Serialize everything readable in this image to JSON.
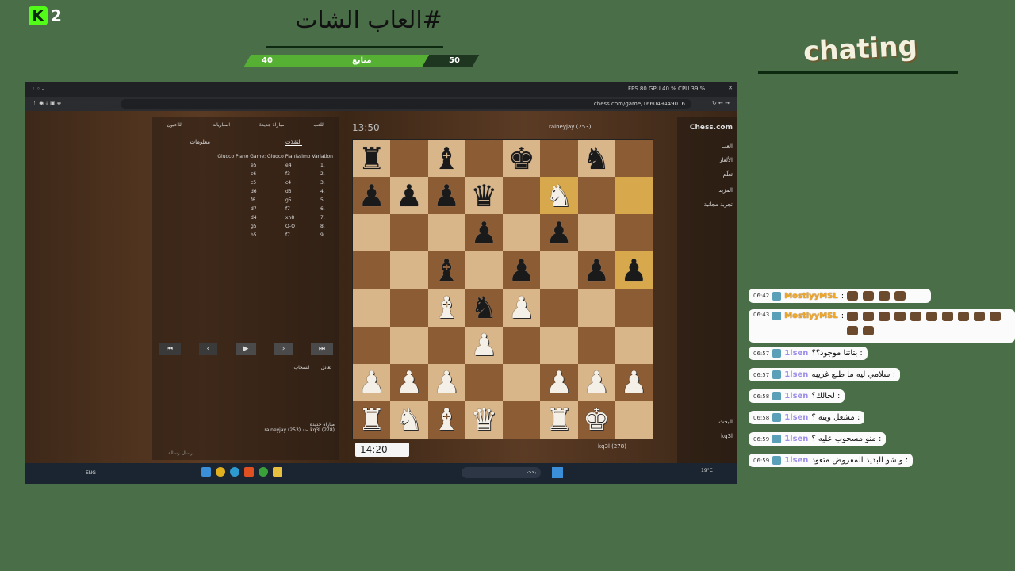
{
  "overlay": {
    "badge_number": "2",
    "title": "#العاب الشات",
    "poll_left_value": "40",
    "poll_center_label": "متابع",
    "poll_right_value": "50",
    "chat_heading": "chating"
  },
  "browser": {
    "tab_stats": "FPS 80 GPU 40 % CPU 39 %",
    "url": "chess.com/game/166049449016"
  },
  "game": {
    "top_clock": "13:50",
    "bottom_clock": "14:20",
    "top_player": "raineyjay (253)",
    "bottom_player": "kq3l (278)",
    "tab_moves": "النقلات",
    "tab_info": "معلومات",
    "opening": "Giuoco Piano Game: Giuoco Pianissimo Variation",
    "moves": [
      [
        "1.",
        "e4",
        "e5"
      ],
      [
        "2.",
        "f3",
        "c6"
      ],
      [
        "3.",
        "c4",
        "c5"
      ],
      [
        "4.",
        "d3",
        "d6"
      ],
      [
        "5.",
        "g5",
        "f6"
      ],
      [
        "6.",
        "f7",
        "d7"
      ],
      [
        "7.",
        "xh8",
        "d4"
      ],
      [
        "8.",
        "O-O",
        "g5"
      ],
      [
        "9.",
        "f7",
        "h5"
      ]
    ],
    "draw_label": "تعادل",
    "resign_label": "انسحاب",
    "new_game_label": "مباراة جديدة",
    "summary_line": "raineyjay (253) ضد kq3l (278)",
    "send_placeholder": "إرسال رسالة...",
    "top_icons": [
      "اللعب",
      "مباراة جديدة",
      "المباريات",
      "اللاعبون"
    ]
  },
  "chess_nav": {
    "brand": "Chess.com",
    "items": [
      "العب",
      "الألغاز",
      "تعلّم",
      "المزيد",
      "تجربة مجانية"
    ],
    "search": "البحث",
    "user": "kq3l"
  },
  "taskbar": {
    "search": "بحث",
    "weather": "19°C",
    "lang": "ENG"
  },
  "board": [
    [
      "bR",
      "",
      "bB",
      "",
      "bK",
      "",
      "bN",
      ""
    ],
    [
      "bP",
      "bP",
      "bP",
      "bQ",
      "",
      "wN",
      "",
      ""
    ],
    [
      "",
      "",
      "",
      "bP",
      "",
      "bP",
      "",
      ""
    ],
    [
      "",
      "",
      "bB",
      "",
      "bP",
      "",
      "bP",
      "bP"
    ],
    [
      "",
      "",
      "wB",
      "bN",
      "wP",
      "",
      "",
      ""
    ],
    [
      "",
      "",
      "",
      "wP",
      "",
      "",
      "",
      ""
    ],
    [
      "wP",
      "wP",
      "wP",
      "",
      "",
      "wP",
      "wP",
      "wP"
    ],
    [
      "wR",
      "wN",
      "wB",
      "wQ",
      "",
      "wR",
      "wK",
      ""
    ]
  ],
  "chat": [
    {
      "time": "06:42",
      "user": "MostlyyMSL",
      "text": ":"
    },
    {
      "time": "06:43",
      "user": "MostlyyMSL",
      "text": ":"
    },
    {
      "time": "06:57",
      "user": "1lsen",
      "text": ": بثاثنا موجود؟؟"
    },
    {
      "time": "06:57",
      "user": "1lsen",
      "text": ": سلامي ليه ما طلع غريبه"
    },
    {
      "time": "06:58",
      "user": "1lsen",
      "text": ": لحالك؟"
    },
    {
      "time": "06:58",
      "user": "1lsen",
      "text": ": مشعل وينه ؟"
    },
    {
      "time": "06:59",
      "user": "1lsen",
      "text": ": منو مسحوب عليه ؟"
    },
    {
      "time": "06:59",
      "user": "1lsen",
      "text": ": و شو البديد المفروض متعود"
    }
  ],
  "colors": {
    "background": "#4a6e48",
    "poll_green": "#55b033",
    "light_square": "#d9b68a",
    "dark_square": "#8c5c35"
  }
}
